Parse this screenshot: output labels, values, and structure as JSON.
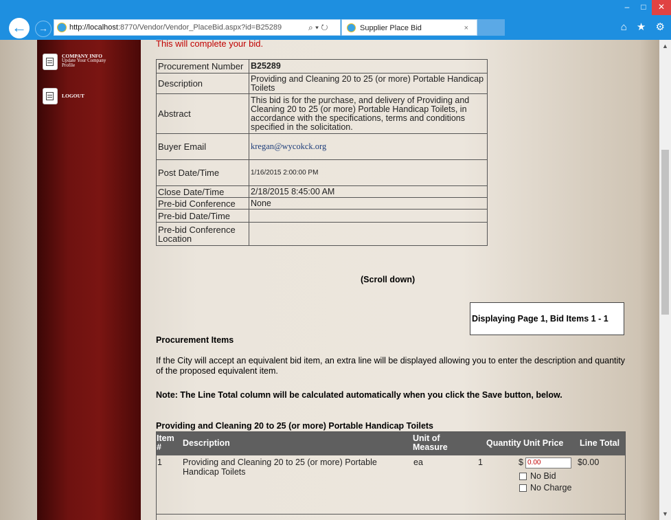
{
  "browser": {
    "url_host": "http://localhost",
    "url_rest": ":8770/Vendor/Vendor_PlaceBid.aspx?id=B25289",
    "search_glyph": "⌕ ▾ ↻",
    "tab_title": "Supplier Place Bid",
    "tab_close": "×",
    "toolbar_icons": "⌂ ★ ⚙"
  },
  "sidebar": {
    "items": [
      {
        "title": "COMPANY INFO",
        "sub1": "Update Your Company",
        "sub2": "Profile"
      },
      {
        "title": "LOGOUT"
      }
    ]
  },
  "main": {
    "completion_message": "This will complete your bid.",
    "info": {
      "procurement_number_label": "Procurement Number",
      "procurement_number": "B25289",
      "description_label": "Description",
      "description": "Providing and Cleaning 20 to 25 (or more) Portable Handicap Toilets",
      "abstract_label": "Abstract",
      "abstract": "This bid is for the purchase, and delivery of Providing and Cleaning 20 to 25 (or more) Portable Handicap Toilets, in accordance with the specifications, terms and conditions specified in the solicitation.",
      "buyer_email_label": "Buyer Email",
      "buyer_email": "kregan@wycokck.org",
      "post_label": "Post Date/Time",
      "post": "1/16/2015 2:00:00 PM",
      "close_label": "Close Date/Time",
      "close": "2/18/2015 8:45:00 AM",
      "prebid_conf_label": "Pre-bid Conference",
      "prebid_conf": "None",
      "prebid_date_label": "Pre-bid Date/Time",
      "prebid_date": "",
      "prebid_loc_label": "Pre-bid Conference Location",
      "prebid_loc": ""
    },
    "scroll_hint": "(Scroll down)",
    "paging": "Displaying Page 1, Bid Items 1 - 1",
    "procurement_items_heading": "Procurement Items",
    "equiv_text": "If the City will accept an equivalent bid item, an extra line will be displayed allowing you to enter the description and quantity of the proposed equivalent item.",
    "note_text": "Note: The Line Total column will be calculated automatically when you click the Save button, below.",
    "group_heading": "Providing and Cleaning 20 to 25 (or more) Portable Handicap Toilets",
    "items_table": {
      "headers": {
        "item": "Item #",
        "description": "Description",
        "uom": "Unit of Measure",
        "quantity": "Quantity",
        "unit_price": "Unit Price",
        "line_total": "Line Total"
      },
      "rows": [
        {
          "item": "1",
          "description": "Providing and Cleaning 20 to 25 (or more) Portable Handicap Toilets",
          "uom": "ea",
          "quantity": "1",
          "currency": "$",
          "unit_price": "0.00",
          "line_total": "$0.00",
          "no_bid_label": "No Bid",
          "no_charge_label": "No Charge"
        }
      ]
    }
  }
}
